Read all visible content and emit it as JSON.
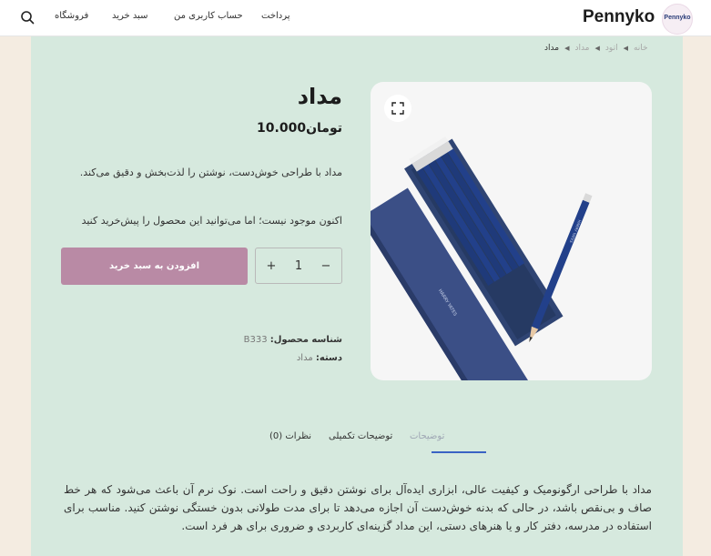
{
  "header": {
    "logo_text": "Pennyko",
    "badge_text": "Pennyko",
    "nav": [
      "پرداخت",
      "حساب کاربری من",
      "سبد خرید",
      "فروشگاه"
    ]
  },
  "breadcrumb": [
    "خانه",
    "اتود",
    "مداد",
    "مداد"
  ],
  "product": {
    "title": "مداد",
    "price": "تومان10.000",
    "short_description": "مداد با طراحی خوش‌دست، نوشتن را لذت‌بخش و دقیق می‌کند.",
    "stock_note": "اکنون موجود نیست؛ اما می‌توانید این محصول را پیش‌خرید کنید",
    "quantity": "1",
    "add_to_cart_label": "افزودن به سبد خرید",
    "sku_label": "شناسه محصول:",
    "sku_value": "B333",
    "category_label": "دسته:",
    "category_value": "مداد",
    "image_text": "HARRY YATES"
  },
  "tabs": [
    "توضیحات",
    "توضیحات تکمیلی",
    "نظرات (0)"
  ],
  "long_description": "مداد با طراحی ارگونومیک و کیفیت عالی، ابزاری ایده‌آل برای نوشتن دقیق و راحت است. نوک نرم آن باعث می‌شود که هر خط صاف و بی‌نقص باشد، در حالی که بدنه خوش‌دست آن اجازه می‌دهد تا برای مدت طولانی بدون خستگی نوشتن کنید. مناسب برای استفاده در مدرسه، دفتر کار و یا هنرهای دستی، این مداد گزینه‌ای کاربردی و ضروری برای هر فرد است.",
  "colors": {
    "accent": "#b98aa5",
    "card_bg": "#d6e9de",
    "tab_active_underline": "#3a63c4"
  },
  "icons": [
    "search-icon",
    "expand-icon"
  ]
}
